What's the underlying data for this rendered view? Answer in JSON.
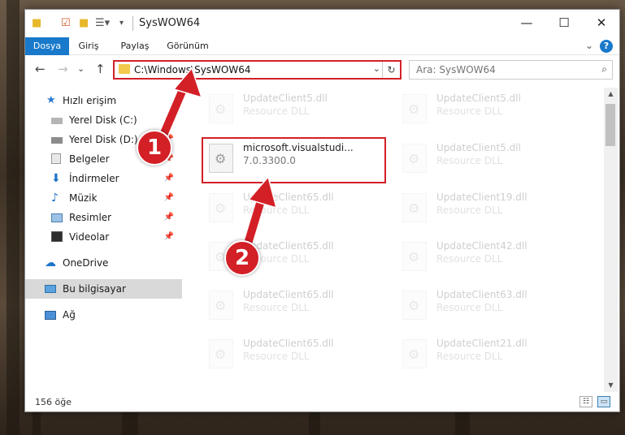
{
  "window": {
    "title": "SysWOW64",
    "minimize": "—",
    "maximize": "☐",
    "close": "✕"
  },
  "ribbon": {
    "tabs": [
      {
        "label": "Dosya",
        "active": true
      },
      {
        "label": "Giriş",
        "active": false
      },
      {
        "label": "Paylaş",
        "active": false
      },
      {
        "label": "Görünüm",
        "active": false
      }
    ],
    "help": "?",
    "collapse": "⌄"
  },
  "nav": {
    "back": "←",
    "forward": "→",
    "recent": "⌄",
    "up": "↑",
    "address_path": "C:\\Windows\\SysWOW64",
    "address_dropdown": "⌄",
    "refresh": "↻",
    "search_placeholder": "Ara: SysWOW64",
    "search_icon": "⌕"
  },
  "sidebar": {
    "items": [
      {
        "label": "Hızlı erişim",
        "icon": "star-icon",
        "pinned": false
      },
      {
        "label": "Yerel Disk (C:)",
        "icon": "drive-icon",
        "pinned": true
      },
      {
        "label": "Yerel Disk (D:)",
        "icon": "drive-icon",
        "pinned": true
      },
      {
        "label": "Belgeler",
        "icon": "documents-icon",
        "pinned": true
      },
      {
        "label": "İndirmeler",
        "icon": "download-icon",
        "pinned": true
      },
      {
        "label": "Müzik",
        "icon": "music-icon",
        "pinned": true
      },
      {
        "label": "Resimler",
        "icon": "pictures-icon",
        "pinned": true
      },
      {
        "label": "Videolar",
        "icon": "videos-icon",
        "pinned": true
      },
      {
        "label": "OneDrive",
        "icon": "cloud-icon",
        "pinned": false
      },
      {
        "label": "Bu bilgisayar",
        "icon": "computer-icon",
        "pinned": false
      },
      {
        "label": "Ağ",
        "icon": "network-icon",
        "pinned": false
      }
    ],
    "pin_glyph": "📌"
  },
  "files": {
    "highlighted": {
      "name": "microsoft.visualstudi...",
      "detail": "7.0.3300.0"
    },
    "left_column": [
      {
        "name": "UpdateClient5.dll",
        "detail": "Resource DLL"
      },
      {
        "name": "UpdateClient65.dll",
        "detail": "Resource DLL"
      },
      {
        "name": "UpdateClient65.dll",
        "detail": "Resource DLL"
      },
      {
        "name": "UpdateClient65.dll",
        "detail": "Resource DLL"
      },
      {
        "name": "UpdateClient65.dll",
        "detail": "Resource DLL"
      }
    ],
    "right_column": [
      {
        "name": "UpdateClient5.dll",
        "detail": "Resource DLL"
      },
      {
        "name": "UpdateClient5.dll",
        "detail": "Resource DLL"
      },
      {
        "name": "UpdateClient19.dll",
        "detail": "Resource DLL"
      },
      {
        "name": "UpdateClient42.dll",
        "detail": "Resource DLL"
      },
      {
        "name": "UpdateClient63.dll",
        "detail": "Resource DLL"
      },
      {
        "name": "UpdateClient21.dll",
        "detail": "Resource DLL"
      }
    ]
  },
  "status": {
    "count": "156 öğe"
  },
  "annotations": {
    "step1": "1",
    "step2": "2",
    "color": "#d32027"
  }
}
